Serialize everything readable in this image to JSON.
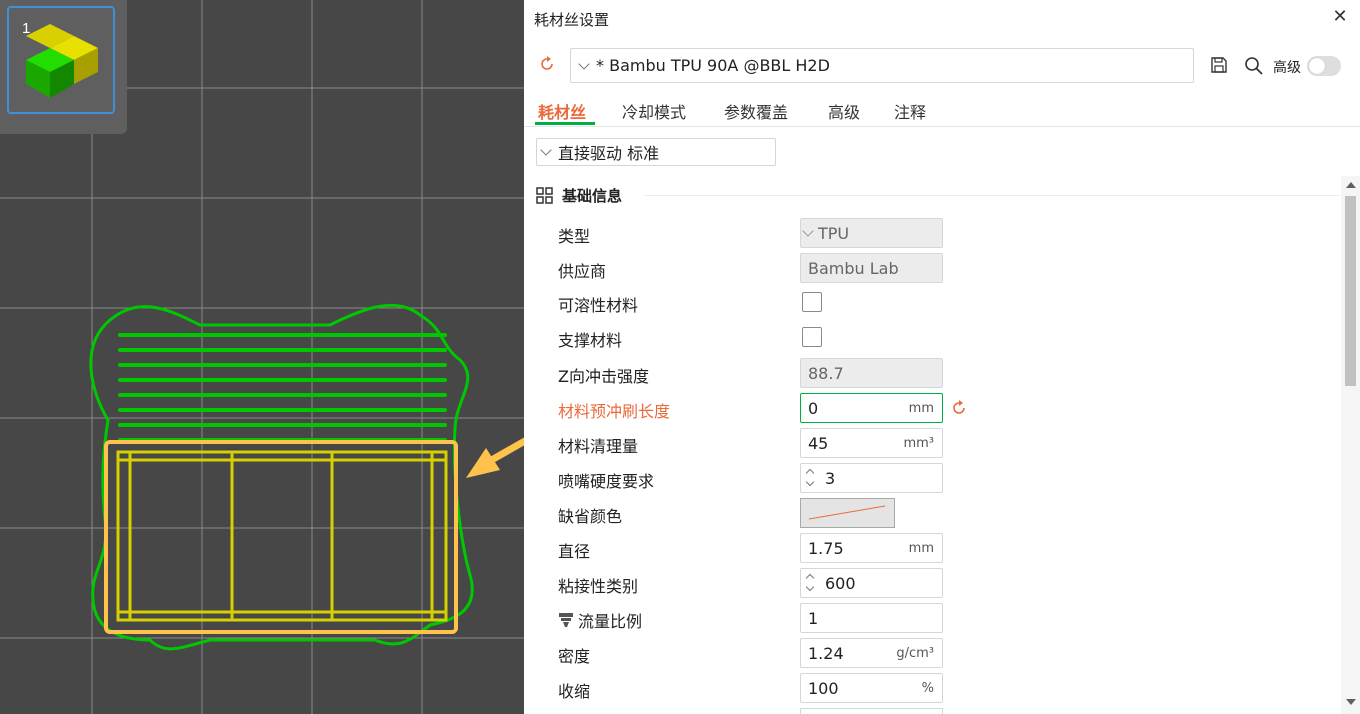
{
  "plate": {
    "number": "1"
  },
  "dialog": {
    "title": "耗材丝设置",
    "preset": "* Bambu TPU 90A @BBL H2D",
    "advanced_label": "高级",
    "tabs": [
      "耗材丝",
      "冷却模式",
      "参数覆盖",
      "高级",
      "注释"
    ],
    "active_tab": "耗材丝",
    "variant": "直接驱动 标准",
    "section_title": "基础信息",
    "rows": {
      "type": {
        "label": "类型",
        "value": "TPU"
      },
      "vendor": {
        "label": "供应商",
        "value": "Bambu Lab"
      },
      "soluble": {
        "label": "可溶性材料",
        "checked": false
      },
      "support": {
        "label": "支撑材料",
        "checked": false
      },
      "impact": {
        "label": "Z向冲击强度",
        "value": "88.7"
      },
      "prime_length": {
        "label": "材料预冲刷长度",
        "value": "0",
        "unit": "mm"
      },
      "flush_volume": {
        "label": "材料清理量",
        "value": "45",
        "unit": "mm³"
      },
      "nozzle_hardness": {
        "label": "喷嘴硬度要求",
        "value": "3"
      },
      "default_color": {
        "label": "缺省颜色"
      },
      "diameter": {
        "label": "直径",
        "value": "1.75",
        "unit": "mm"
      },
      "adhesion": {
        "label": "粘接性类别",
        "value": "600"
      },
      "flow_ratio": {
        "label": "流量比例",
        "value": "1"
      },
      "density": {
        "label": "密度",
        "value": "1.24",
        "unit": "g/cm³"
      },
      "shrinkage": {
        "label": "收缩",
        "value": "100",
        "unit": "%"
      }
    }
  },
  "colors": {
    "accent": "#ea6a3c",
    "brand_green": "#00ae42",
    "toolpath_green": "#00c800",
    "toolpath_yellow": "#d6d000",
    "highlight": "#ffc34d"
  },
  "icons": [
    "reset-icon",
    "save-icon",
    "search-icon",
    "close-icon",
    "section-grid-icon",
    "nozzle-icon"
  ]
}
